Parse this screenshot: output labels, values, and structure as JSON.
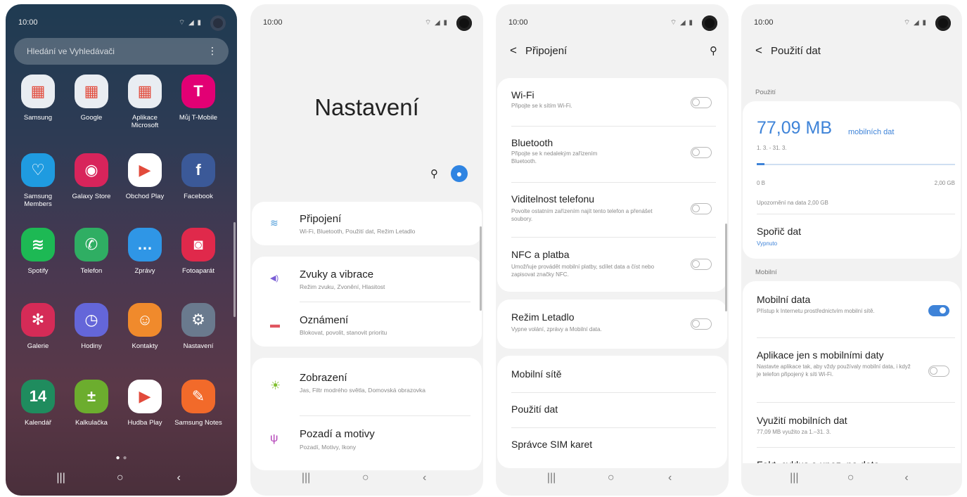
{
  "status_time": "10:00",
  "status_icons": "⌔ ◢ ▮",
  "home": {
    "search_placeholder": "Hledání ve Vyhledávači",
    "apps": [
      {
        "label": "Samsung",
        "bg": "#e9edf2",
        "glyph": "▦"
      },
      {
        "label": "Google",
        "bg": "#e9edf2",
        "glyph": "▦"
      },
      {
        "label": "Aplikace Microsoft",
        "bg": "#e9edf2",
        "glyph": "▦"
      },
      {
        "label": "Můj T-Mobile",
        "bg": "#e20074",
        "glyph": "T"
      },
      {
        "label": "Samsung Members",
        "bg": "#1f9be0",
        "glyph": "♡"
      },
      {
        "label": "Galaxy Store",
        "bg": "#d8245b",
        "glyph": "◉"
      },
      {
        "label": "Obchod Play",
        "bg": "#ffffff",
        "glyph": "▶"
      },
      {
        "label": "Facebook",
        "bg": "#3b5998",
        "glyph": "f"
      },
      {
        "label": "Spotify",
        "bg": "#1db954",
        "glyph": "≋"
      },
      {
        "label": "Telefon",
        "bg": "#2fae63",
        "glyph": "✆"
      },
      {
        "label": "Zprávy",
        "bg": "#2f96e6",
        "glyph": "…"
      },
      {
        "label": "Fotoaparát",
        "bg": "#e0294b",
        "glyph": "◙"
      },
      {
        "label": "Galerie",
        "bg": "#d52b57",
        "glyph": "✻"
      },
      {
        "label": "Hodiny",
        "bg": "#6466d9",
        "glyph": "◷"
      },
      {
        "label": "Kontakty",
        "bg": "#f08a2c",
        "glyph": "☺"
      },
      {
        "label": "Nastavení",
        "bg": "#6a7a8e",
        "glyph": "⚙"
      },
      {
        "label": "Kalendář",
        "bg": "#1f8c5e",
        "glyph": "14"
      },
      {
        "label": "Kalkulačka",
        "bg": "#6cad2e",
        "glyph": "±"
      },
      {
        "label": "Hudba Play",
        "bg": "#ffffff",
        "glyph": "▶"
      },
      {
        "label": "Samsung Notes",
        "bg": "#f26a2a",
        "glyph": "✎"
      }
    ]
  },
  "settings": {
    "title": "Nastavení",
    "items": [
      {
        "title": "Připojení",
        "subtitle": "Wi-Fi, Bluetooth, Použití dat, Režim Letadlo",
        "icon": "wifi-icon",
        "glyph": "≋",
        "color": "#4a9ad8"
      },
      {
        "title": "Zvuky a vibrace",
        "subtitle": "Režim zvuku, Zvonění, Hlasitost",
        "icon": "speaker-icon",
        "glyph": "◀)",
        "color": "#7b5fd6"
      },
      {
        "title": "Oznámení",
        "subtitle": "Blokovat, povolit, stanovit prioritu",
        "icon": "notification-icon",
        "glyph": "▬",
        "color": "#e05560"
      },
      {
        "title": "Zobrazení",
        "subtitle": "Jas, Filtr modrého světla, Domovská obrazovka",
        "icon": "sun-icon",
        "glyph": "☀",
        "color": "#7fbf2e"
      },
      {
        "title": "Pozadí a motivy",
        "subtitle": "Pozadí, Motivy, Ikony",
        "icon": "brush-icon",
        "glyph": "ψ",
        "color": "#b23fb7"
      }
    ]
  },
  "connections": {
    "title": "Připojení",
    "items": [
      {
        "title": "Wi-Fi",
        "subtitle": "Připojte se k sítím Wi-Fi."
      },
      {
        "title": "Bluetooth",
        "subtitle": "Připojte se k nedalekým zařízením Bluetooth."
      },
      {
        "title": "Viditelnost telefonu",
        "subtitle": "Povolte ostatním zařízením najít tento telefon a přenášet soubory."
      },
      {
        "title": "NFC a platba",
        "subtitle": "Umožňuje provádět mobilní platby, sdílet data a číst nebo zapisovat značky NFC."
      },
      {
        "title": "Režim Letadlo",
        "subtitle": "Vypne volání, zprávy a Mobilní data."
      },
      {
        "title": "Mobilní sítě"
      },
      {
        "title": "Použití dat"
      },
      {
        "title": "Správce SIM karet"
      }
    ]
  },
  "data_usage": {
    "title": "Použití dat",
    "section_usage": "Použití",
    "amount": "77,09 MB",
    "amount_suffix": "mobilních dat",
    "period": "1. 3. - 31. 3.",
    "bar_min": "0 B",
    "bar_max": "2,00 GB",
    "bar_fill_fraction": 0.04,
    "warning": "Upozornění na data 2,00 GB",
    "saver_title": "Spořič dat",
    "saver_status": "Vypnuto",
    "section_mobile": "Mobilní",
    "mobile_data_title": "Mobilní data",
    "mobile_data_sub": "Přístup k Internetu prostřednictvím mobilní sítě.",
    "mobile_data_on": true,
    "apps_only_title": "Aplikace jen s mobilními daty",
    "apps_only_sub": "Nastavte aplikace tak, aby vždy používaly mobilní data, i když je telefon připojený k síti Wi-Fi.",
    "usage_title": "Využití mobilních dat",
    "usage_sub": "77,09 MB využito za 1.–31. 3.",
    "cycle_title": "Fakt. cyklus a upoz. na data",
    "accent": "#3e83d8"
  },
  "nav": {
    "recent": "|||",
    "home": "○",
    "back": "‹"
  }
}
